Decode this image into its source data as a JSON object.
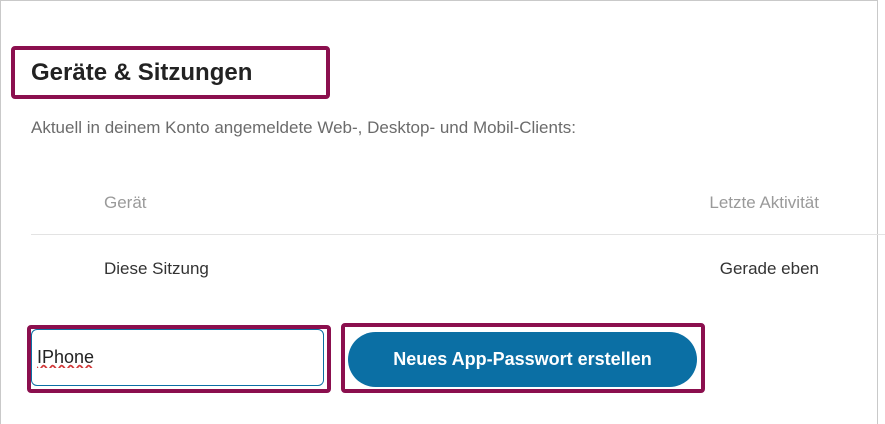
{
  "section": {
    "title": "Geräte & Sitzungen",
    "subtitle": "Aktuell in deinem Konto angemeldete Web-, Desktop- und Mobil-Clients:"
  },
  "sessions_table": {
    "columns": [
      "Gerät",
      "Letzte Aktivität"
    ],
    "rows": [
      {
        "device": "Diese Sitzung",
        "last_activity": "Gerade eben"
      }
    ]
  },
  "app_password": {
    "device_name_value": "IPhone",
    "create_button_label": "Neues App-Passwort erstellen"
  },
  "colors": {
    "accent": "#0b6fa4",
    "highlight": "#8b0f4e"
  }
}
